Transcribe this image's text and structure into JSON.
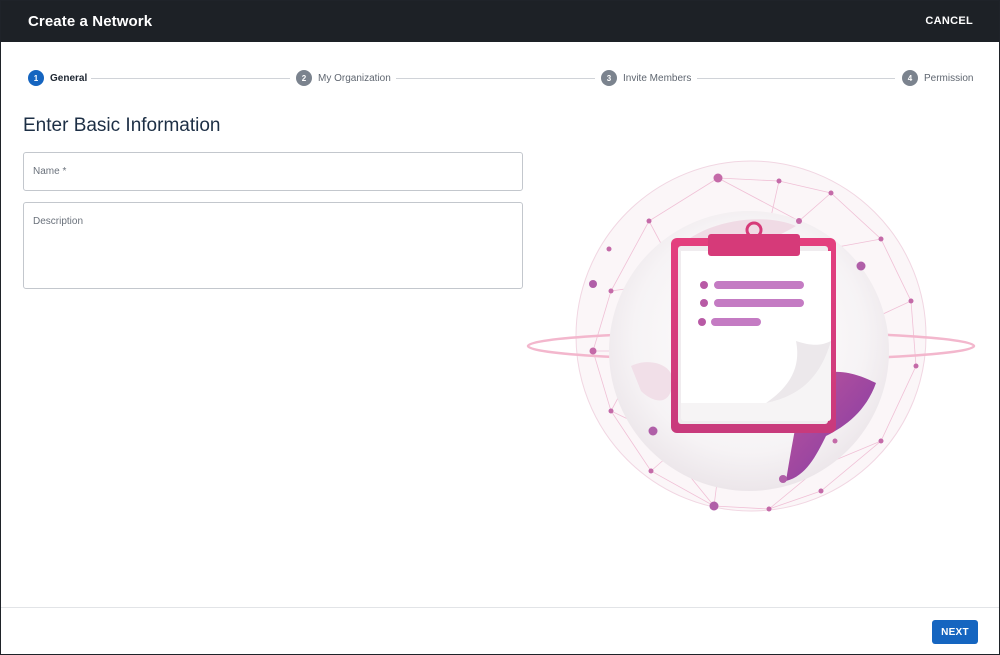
{
  "window": {
    "title": "Create a Network",
    "cancel_label": "CANCEL"
  },
  "stepper": {
    "steps": [
      {
        "number": "1",
        "label": "General",
        "state": "active"
      },
      {
        "number": "2",
        "label": "My Organization",
        "state": "upcoming"
      },
      {
        "number": "3",
        "label": "Invite Members",
        "state": "upcoming"
      },
      {
        "number": "4",
        "label": "Permission",
        "state": "upcoming"
      }
    ]
  },
  "form": {
    "heading": "Enter Basic Information",
    "name": {
      "label": "Name *",
      "value": ""
    },
    "description": {
      "label": "Description",
      "value": ""
    }
  },
  "illustration": {
    "icon": "clipboard-globe-network-illustration"
  },
  "footer": {
    "next_label": "NEXT"
  },
  "colors": {
    "titlebar_bg": "#1d2126",
    "accent": "#1565c0",
    "step_active": "#1565c0",
    "step_inactive": "#7b838e",
    "heading_text": "#1d2f45",
    "illustration_pink": "#e0457e",
    "illustration_purple": "#8d3ba8"
  }
}
